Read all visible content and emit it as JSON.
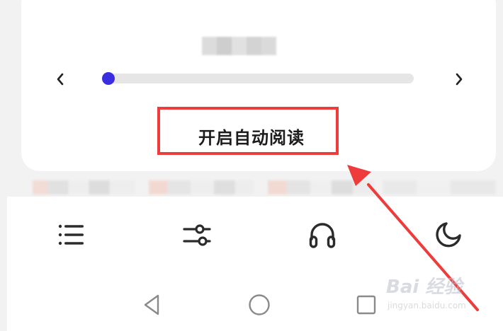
{
  "panel": {
    "auto_read_label": "开启自动阅读",
    "progress": 0.01
  },
  "toolbar": {
    "items": [
      {
        "name": "list-icon"
      },
      {
        "name": "sliders-icon"
      },
      {
        "name": "headphones-icon"
      },
      {
        "name": "moon-icon"
      }
    ]
  },
  "system_nav": {
    "items": [
      {
        "name": "back-triangle-icon"
      },
      {
        "name": "home-circle-icon"
      },
      {
        "name": "recent-square-icon"
      }
    ]
  },
  "watermark": {
    "main": "Bai 经验",
    "sub": "jingyan.baidu.com"
  },
  "colors": {
    "accent": "#3a2ee0",
    "annotation_red": "#ee3b3b",
    "icon": "#2b2b2b"
  }
}
